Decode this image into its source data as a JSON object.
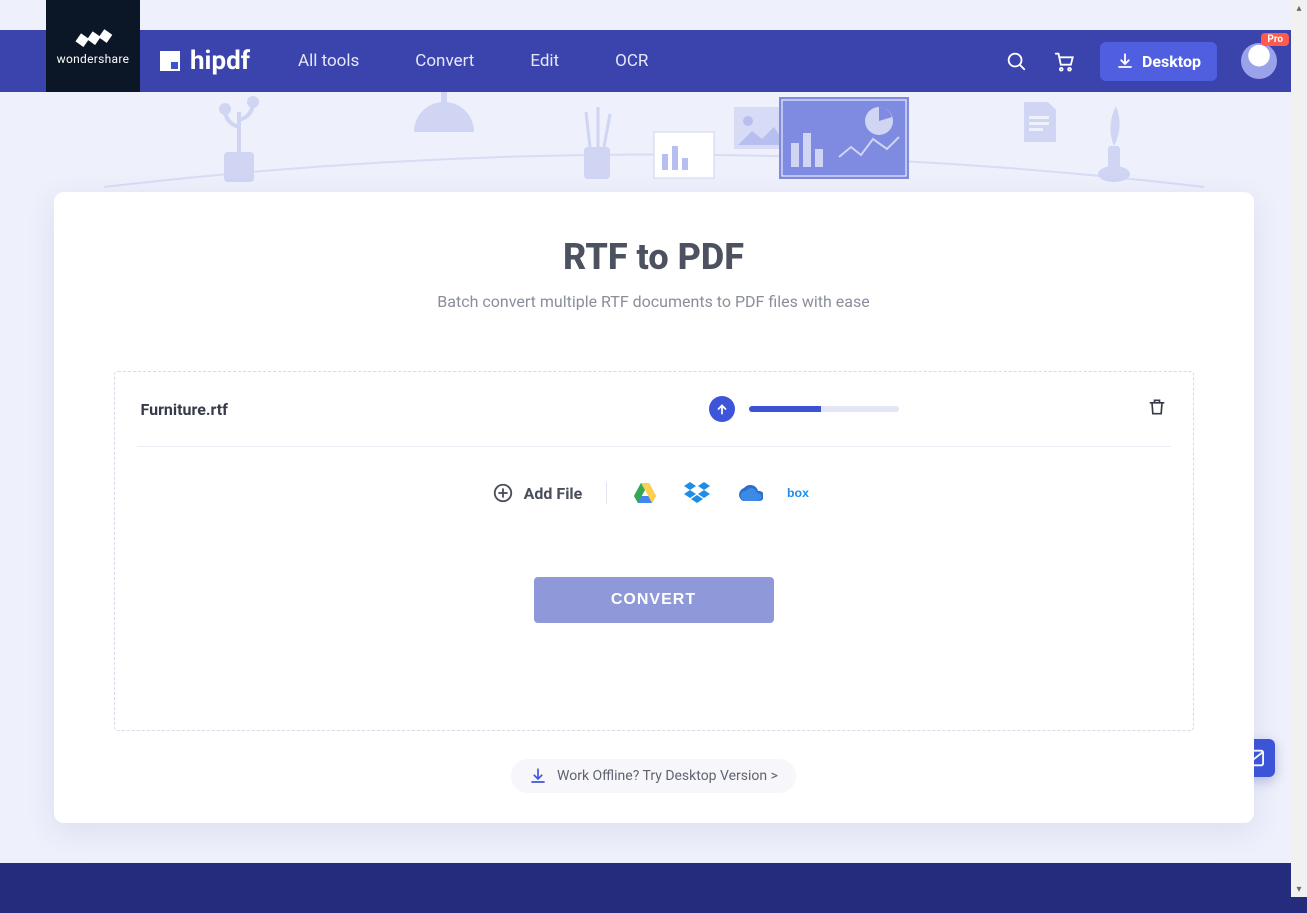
{
  "brand": {
    "parent": "wondershare",
    "name": "hipdf"
  },
  "nav": {
    "all_tools": "All tools",
    "convert": "Convert",
    "edit": "Edit",
    "ocr": "OCR"
  },
  "header": {
    "desktop_label": "Desktop",
    "pro_badge": "Pro"
  },
  "page": {
    "title": "RTF to PDF",
    "subtitle": "Batch convert multiple RTF documents to PDF files with ease"
  },
  "file": {
    "name": "Furniture.rtf",
    "progress_percent": 48
  },
  "actions": {
    "add_file": "Add File",
    "convert": "CONVERT",
    "offline": "Work Offline? Try Desktop Version >"
  },
  "cloud_sources": {
    "gdrive": "google-drive",
    "dropbox": "dropbox",
    "onedrive": "onedrive",
    "box": "box"
  }
}
